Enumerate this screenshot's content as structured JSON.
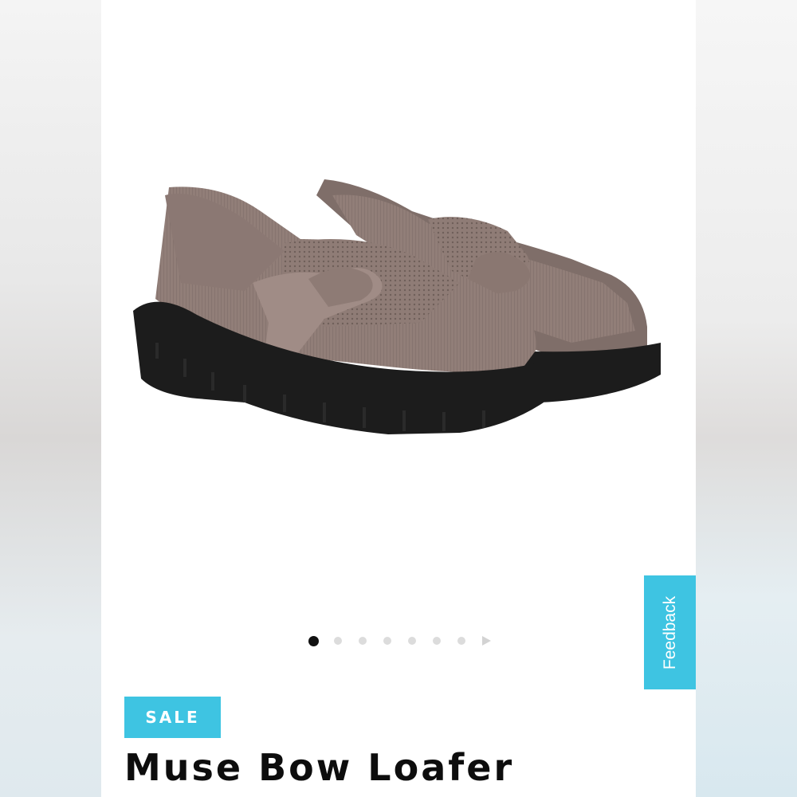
{
  "colors": {
    "accent": "#3ec4e2",
    "shoe_upper": "#8f7c76",
    "sole": "#1c1c1c"
  },
  "product": {
    "image_alt": "Muse Bow Loafer",
    "badge": "SALE",
    "title": "Muse Bow Loafer"
  },
  "carousel": {
    "total_dots": 7,
    "active_index": 0,
    "next_icon": "chevron-right-icon"
  },
  "feedback": {
    "label": "Feedback"
  }
}
